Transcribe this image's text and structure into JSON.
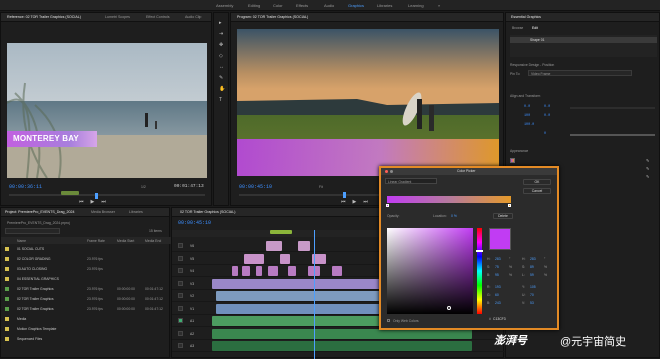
{
  "workspaces": [
    "Assembly",
    "Editing",
    "Color",
    "Effects",
    "Audio",
    "Graphics",
    "Libraries",
    "Learning"
  ],
  "active_workspace": "Graphics",
  "source_panel": {
    "tabs": [
      "Reference: 02 TOR Trailer Graphics (SOCIAL)",
      "Lumetri Scopes",
      "Effect Controls",
      "Audio Clip"
    ],
    "title_text": "MONTEREY BAY",
    "timecode_left": "00:00:36:11",
    "timecode_right": "00:01:47:13",
    "fit_label": "1/2"
  },
  "program_panel": {
    "tabs": [
      "Program: 02 TOR Trailer Graphics (SOCIAL)"
    ],
    "timecode_left": "00:00:45:10",
    "fit_label": "Fit"
  },
  "project_panel": {
    "tabs": [
      "Project: PremierePro_EVENTS_Drag_2024",
      "Media Browser",
      "Libraries"
    ],
    "path": "PremierePro_EVENTS_Drag_2024.prproj",
    "item_count": "15 items",
    "columns": [
      "Name",
      "Frame Rate",
      "Media Start",
      "Media End"
    ],
    "rows": [
      {
        "name": "01 SOCIAL CUTS",
        "rate": "",
        "start": "",
        "end": ""
      },
      {
        "name": "02 COLOR GRADING",
        "rate": "23.976 fps",
        "start": "",
        "end": ""
      },
      {
        "name": "03 AUTO CLOSING",
        "rate": "23.976 fps",
        "start": "",
        "end": ""
      },
      {
        "name": "04 ESSENTIAL GRAPHICS",
        "rate": "",
        "start": "",
        "end": ""
      },
      {
        "name": "02 TOR Trailer Graphics",
        "rate": "23.976 fps",
        "start": "00:00:00:00",
        "end": "00:01:47:12"
      },
      {
        "name": "02 TOR Trailer Graphics",
        "rate": "23.976 fps",
        "start": "00:00:00:00",
        "end": "00:01:47:12"
      },
      {
        "name": "02 TOR Trailer Graphics",
        "rate": "23.976 fps",
        "start": "00:00:00:00",
        "end": "00:01:47:12"
      },
      {
        "name": "Media",
        "rate": "",
        "start": "",
        "end": ""
      },
      {
        "name": "Motion Graphics Template",
        "rate": "",
        "start": "",
        "end": ""
      },
      {
        "name": "Sequenced Files",
        "rate": "",
        "start": "",
        "end": ""
      }
    ]
  },
  "timeline": {
    "tab": "02 TOR Trailer Graphics (SOCIAL)",
    "timecode": "00:00:45:10",
    "tracks": [
      "V6",
      "V5",
      "V4",
      "V3",
      "V2",
      "V1",
      "A1",
      "A2",
      "A3"
    ]
  },
  "essential_graphics": {
    "tab": "Essential Graphics",
    "subtabs": [
      "Browse",
      "Edit"
    ],
    "layer_name": "Shape 01",
    "responsive_label": "Responsive Design - Position",
    "pin_to_label": "Pin To:",
    "pin_to_value": "Video Frame",
    "align_label": "Align and Transform",
    "appearance_label": "Appearance",
    "values": [
      "0.0",
      "0.0",
      "100",
      "0.0",
      "100.0",
      "0"
    ]
  },
  "color_picker": {
    "title": "Color Picker",
    "mode": "Linear Gradient",
    "ok_label": "OK",
    "cancel_label": "Cancel",
    "opacity_label": "Opacity:",
    "location_label": "Location:",
    "location_value": "0 %",
    "delete_label": "Delete",
    "only_web_label": "Only Web Colors",
    "hex_value": "C13CF3",
    "hsb": [
      {
        "l": "H:",
        "v": "283",
        "u": "°"
      },
      {
        "l": "S:",
        "v": "75",
        "u": "%"
      },
      {
        "l": "B:",
        "v": "95",
        "u": "%"
      }
    ],
    "rgb": [
      {
        "l": "R:",
        "v": "193"
      },
      {
        "l": "G:",
        "v": "60"
      },
      {
        "l": "B:",
        "v": "243"
      }
    ],
    "hsl": [
      {
        "l": "H:",
        "v": "283",
        "u": "°"
      },
      {
        "l": "S:",
        "v": "89",
        "u": "%"
      },
      {
        "l": "L:",
        "v": "59",
        "u": "%"
      }
    ],
    "yuv": [
      {
        "l": "Y:",
        "v": "105"
      },
      {
        "l": "U:",
        "v": "70"
      },
      {
        "l": "V:",
        "v": "53"
      }
    ]
  },
  "watermark": {
    "left": "澎湃号",
    "right": "@元宇宙简史"
  }
}
